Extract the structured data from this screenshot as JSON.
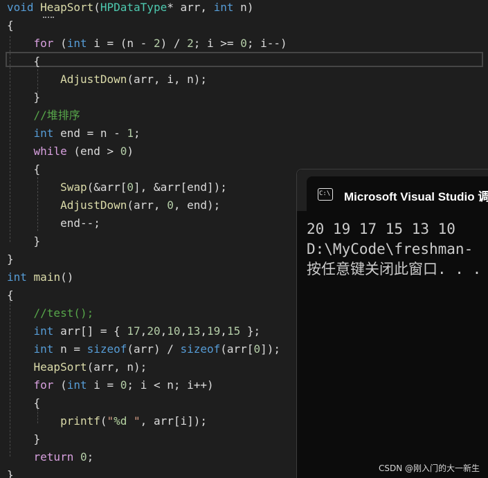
{
  "editor": {
    "lines": [
      [
        {
          "t": "void",
          "c": "kw"
        },
        {
          "t": " ",
          "c": "pl"
        },
        {
          "t": "HeapSort",
          "c": "fn"
        },
        {
          "t": "(",
          "c": "pl"
        },
        {
          "t": "HPDataType",
          "c": "ty"
        },
        {
          "t": "* arr, ",
          "c": "pl"
        },
        {
          "t": "int",
          "c": "kw"
        },
        {
          "t": " n)",
          "c": "pl"
        }
      ],
      [
        {
          "t": "{",
          "c": "pl"
        }
      ],
      [
        {
          "t": "    ",
          "c": "pl"
        },
        {
          "t": "for",
          "c": "ctl"
        },
        {
          "t": " (",
          "c": "pl"
        },
        {
          "t": "int",
          "c": "kw"
        },
        {
          "t": " i = (n - ",
          "c": "pl"
        },
        {
          "t": "2",
          "c": "num"
        },
        {
          "t": ") / ",
          "c": "pl"
        },
        {
          "t": "2",
          "c": "num"
        },
        {
          "t": "; i >= ",
          "c": "pl"
        },
        {
          "t": "0",
          "c": "num"
        },
        {
          "t": "; i--)",
          "c": "pl"
        }
      ],
      [
        {
          "t": "    {",
          "c": "pl"
        }
      ],
      [
        {
          "t": "        ",
          "c": "pl"
        },
        {
          "t": "AdjustDown",
          "c": "fn"
        },
        {
          "t": "(arr, i, n);",
          "c": "pl"
        }
      ],
      [
        {
          "t": "    }",
          "c": "pl"
        }
      ],
      [
        {
          "t": "    ",
          "c": "pl"
        },
        {
          "t": "//堆排序",
          "c": "cmt"
        }
      ],
      [
        {
          "t": "    ",
          "c": "pl"
        },
        {
          "t": "int",
          "c": "kw"
        },
        {
          "t": " end = n - ",
          "c": "pl"
        },
        {
          "t": "1",
          "c": "num"
        },
        {
          "t": ";",
          "c": "pl"
        }
      ],
      [
        {
          "t": "    ",
          "c": "pl"
        },
        {
          "t": "while",
          "c": "ctl"
        },
        {
          "t": " (end > ",
          "c": "pl"
        },
        {
          "t": "0",
          "c": "num"
        },
        {
          "t": ")",
          "c": "pl"
        }
      ],
      [
        {
          "t": "    {",
          "c": "pl"
        }
      ],
      [
        {
          "t": "        ",
          "c": "pl"
        },
        {
          "t": "Swap",
          "c": "fn"
        },
        {
          "t": "(&arr[",
          "c": "pl"
        },
        {
          "t": "0",
          "c": "num"
        },
        {
          "t": "], &arr[end]);",
          "c": "pl"
        }
      ],
      [
        {
          "t": "        ",
          "c": "pl"
        },
        {
          "t": "AdjustDown",
          "c": "fn"
        },
        {
          "t": "(arr, ",
          "c": "pl"
        },
        {
          "t": "0",
          "c": "num"
        },
        {
          "t": ", end);",
          "c": "pl"
        }
      ],
      [
        {
          "t": "        end--;",
          "c": "pl"
        }
      ],
      [
        {
          "t": "    }",
          "c": "pl"
        }
      ],
      [
        {
          "t": "}",
          "c": "pl"
        }
      ],
      [
        {
          "t": "int",
          "c": "kw"
        },
        {
          "t": " ",
          "c": "pl"
        },
        {
          "t": "main",
          "c": "fn"
        },
        {
          "t": "()",
          "c": "pl"
        }
      ],
      [
        {
          "t": "{",
          "c": "pl"
        }
      ],
      [
        {
          "t": "    ",
          "c": "pl"
        },
        {
          "t": "//test();",
          "c": "cmt"
        }
      ],
      [
        {
          "t": "    ",
          "c": "pl"
        },
        {
          "t": "int",
          "c": "kw"
        },
        {
          "t": " arr[] = { ",
          "c": "pl"
        },
        {
          "t": "17",
          "c": "num"
        },
        {
          "t": ",",
          "c": "pl"
        },
        {
          "t": "20",
          "c": "num"
        },
        {
          "t": ",",
          "c": "pl"
        },
        {
          "t": "10",
          "c": "num"
        },
        {
          "t": ",",
          "c": "pl"
        },
        {
          "t": "13",
          "c": "num"
        },
        {
          "t": ",",
          "c": "pl"
        },
        {
          "t": "19",
          "c": "num"
        },
        {
          "t": ",",
          "c": "pl"
        },
        {
          "t": "15",
          "c": "num"
        },
        {
          "t": " };",
          "c": "pl"
        }
      ],
      [
        {
          "t": "    ",
          "c": "pl"
        },
        {
          "t": "int",
          "c": "kw"
        },
        {
          "t": " n = ",
          "c": "pl"
        },
        {
          "t": "sizeof",
          "c": "kw"
        },
        {
          "t": "(arr) / ",
          "c": "pl"
        },
        {
          "t": "sizeof",
          "c": "kw"
        },
        {
          "t": "(arr[",
          "c": "pl"
        },
        {
          "t": "0",
          "c": "num"
        },
        {
          "t": "]);",
          "c": "pl"
        }
      ],
      [
        {
          "t": "    ",
          "c": "pl"
        },
        {
          "t": "HeapSort",
          "c": "fn"
        },
        {
          "t": "(arr, n);",
          "c": "pl"
        }
      ],
      [
        {
          "t": "    ",
          "c": "pl"
        },
        {
          "t": "for",
          "c": "ctl"
        },
        {
          "t": " (",
          "c": "pl"
        },
        {
          "t": "int",
          "c": "kw"
        },
        {
          "t": " i = ",
          "c": "pl"
        },
        {
          "t": "0",
          "c": "num"
        },
        {
          "t": "; i < n; i++)",
          "c": "pl"
        }
      ],
      [
        {
          "t": "    {",
          "c": "pl"
        }
      ],
      [
        {
          "t": "        ",
          "c": "pl"
        },
        {
          "t": "printf",
          "c": "fn"
        },
        {
          "t": "(",
          "c": "pl"
        },
        {
          "t": "\"",
          "c": "str"
        },
        {
          "t": "%d",
          "c": "fmt"
        },
        {
          "t": " \"",
          "c": "str"
        },
        {
          "t": ", arr[i]);",
          "c": "pl"
        }
      ],
      [
        {
          "t": "    }",
          "c": "pl"
        }
      ],
      [
        {
          "t": "    ",
          "c": "ctl"
        },
        {
          "t": "return",
          "c": "ctl"
        },
        {
          "t": " ",
          "c": "pl"
        },
        {
          "t": "0",
          "c": "num"
        },
        {
          "t": ";",
          "c": "pl"
        }
      ],
      [
        {
          "t": "}",
          "c": "pl"
        }
      ]
    ]
  },
  "console": {
    "icon_label": "C:\\",
    "title": "Microsoft Visual Studio 调",
    "output": [
      "20 19 17 15 13 10",
      "D:\\MyCode\\freshman-",
      "按任意键关闭此窗口. . ."
    ]
  },
  "watermark": "CSDN @刚入门的大一新生",
  "colors": {
    "editor_bg": "#1e1e1e",
    "keyword": "#569cd6",
    "control": "#d8a0df",
    "function": "#dcdcaa",
    "type": "#4ec9b0",
    "number": "#b5cea8",
    "comment": "#57a64a",
    "console_bg": "#0c0c0c"
  }
}
